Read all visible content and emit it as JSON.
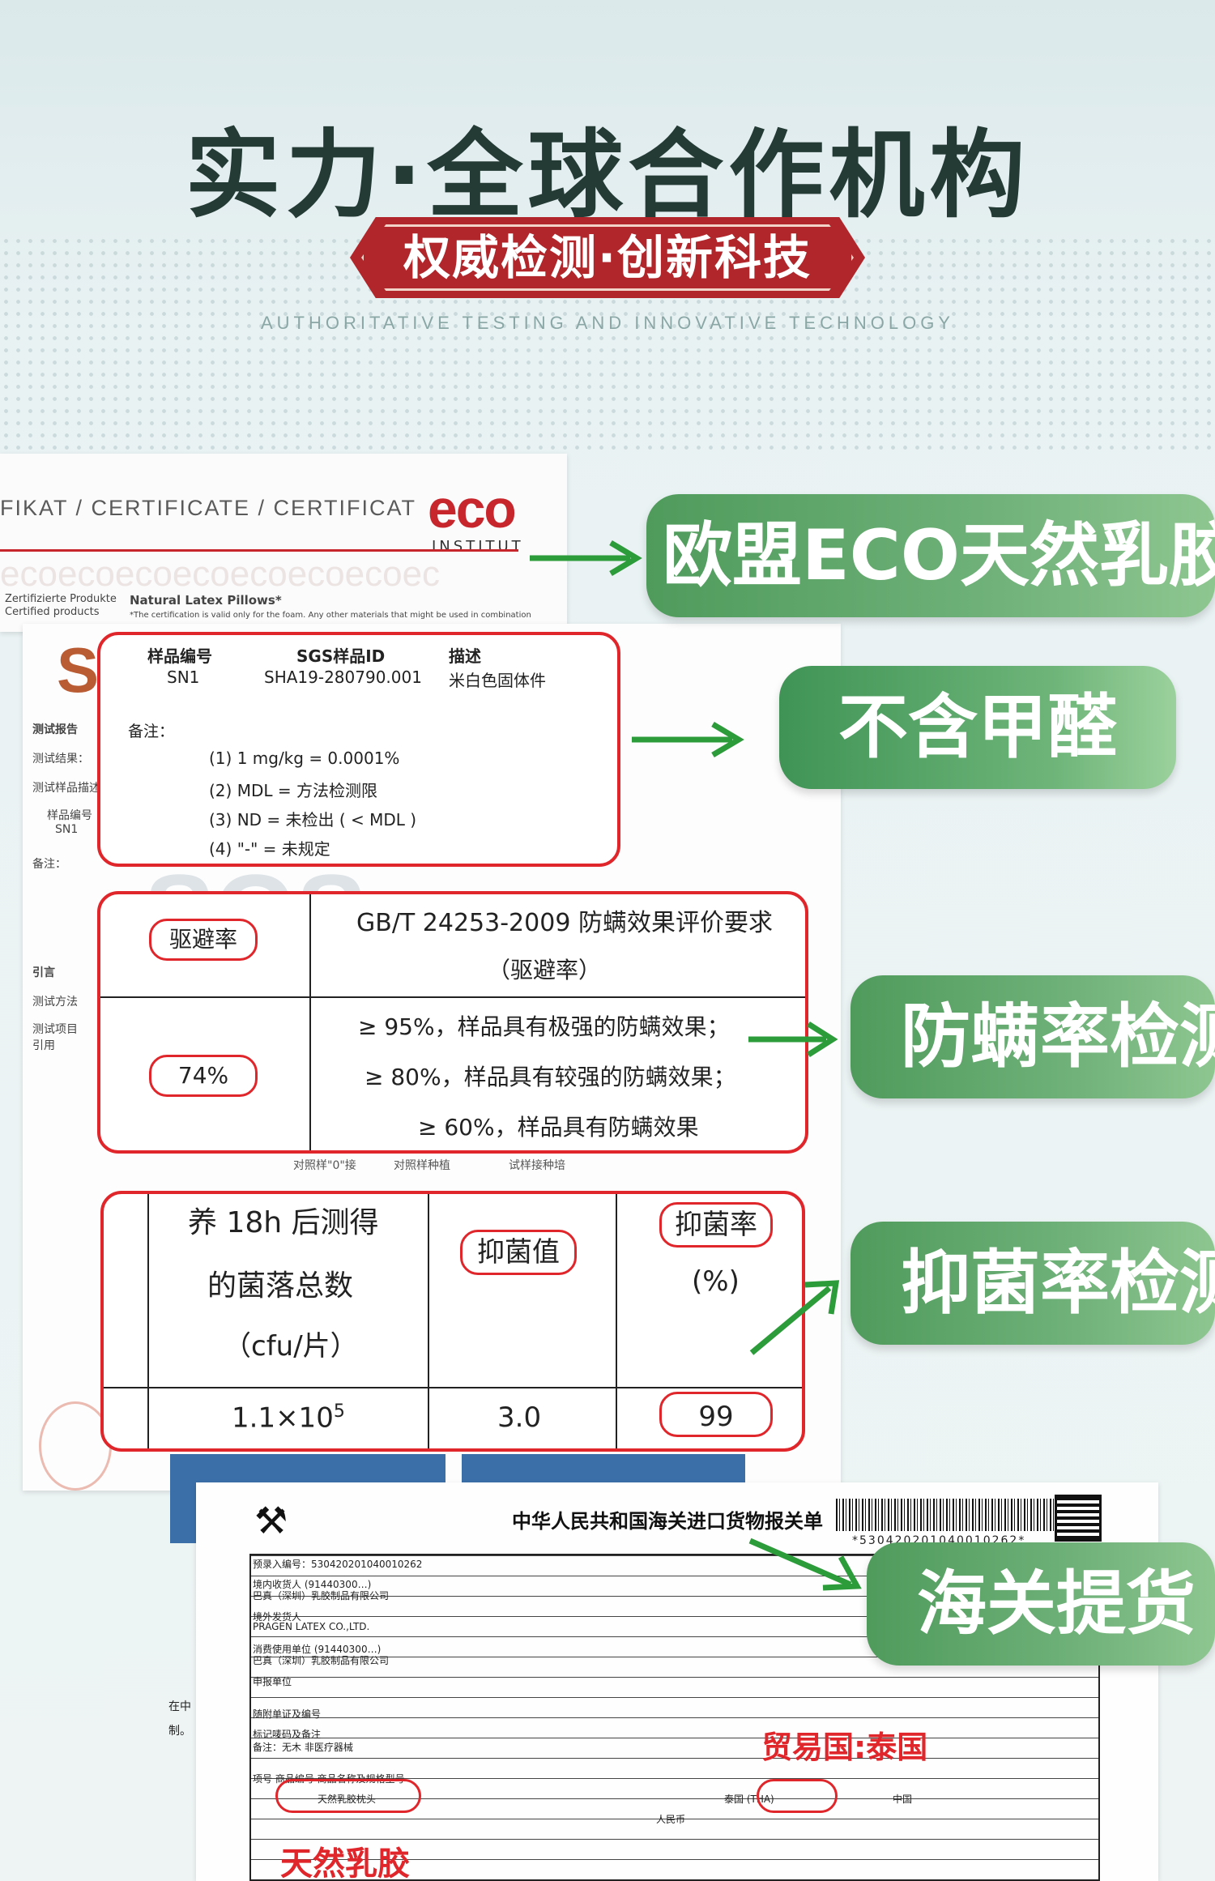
{
  "header": {
    "title": "实力·全球合作机构",
    "ribbon": "权威检测·创新科技",
    "subtitle": "AUTHORITATIVE TESTING AND INNOVATIVE TECHNOLOGY"
  },
  "eco_certificate": {
    "strip": "FIKAT / CERTIFICATE / CERTIFICAT",
    "logo": "eco",
    "institut": "INSTITUT",
    "watermark": "ecoecoecoecoecoecoecoec",
    "small_left": "Zertifizierte Produkte",
    "small_left2": "Certified products",
    "small_product": "Natural Latex Pillows*",
    "small_note": "*The certification is valid only for the foam. Any other materials that might be used in combination"
  },
  "sgs_report": {
    "logo": "SG",
    "watermark": "SGS",
    "side_labels": [
      "测试报告",
      "测试结果：",
      "测试样品描述",
      "样品编号",
      "SN1",
      "备注：",
      "引言",
      "测试方法",
      "测试项目",
      "引用"
    ]
  },
  "formaldehyde_box": {
    "headers": [
      "样品编号",
      "SGS样品ID",
      "描述"
    ],
    "row": [
      "SN1",
      "SHA19-280790.001",
      "米白色固体件"
    ],
    "notes_label": "备注：",
    "notes": [
      "(1) 1 mg/kg = 0.0001%",
      "(2) MDL = 方法检测限",
      "(3) ND = 未检出 ( < MDL )",
      "(4) \"-\" = 未规定"
    ]
  },
  "mite_box": {
    "label": "驱避率",
    "value": "74%",
    "standard_line1": "GB/T 24253-2009 防螨效果评价要求",
    "standard_line2": "（驱避率）",
    "criteria": [
      "≥ 95%，样品具有极强的防螨效果；",
      "≥ 80%，样品具有较强的防螨效果；",
      "≥ 60%，样品具有防螨效果"
    ],
    "under_headers": [
      "对照样\"0\"接",
      "对照样种植",
      "试样接种培"
    ]
  },
  "antibacterial_box": {
    "col1_line1": "养 18h 后测得",
    "col1_line2": "的菌落总数",
    "col1_line3": "（cfu/片）",
    "col2": "抑菌值",
    "col3_line1": "抑菌率",
    "col3_line2": "(%)",
    "val1": "1.1×10",
    "val1_exp": "5",
    "val2": "3.0",
    "val3": "99"
  },
  "callouts": {
    "eco": "欧盟ECO天然乳胶认证",
    "formaldehyde": "不含甲醛",
    "mite": "防螨率检测",
    "antibacterial": "抑菌率检测",
    "customs": "海关提货"
  },
  "customs_doc": {
    "title": "中华人民共和国海关进口货物报关单",
    "barcode_text": "*530420201040010262*",
    "trade_country": "贸易国:泰国",
    "natural_latex": "天然乳胶",
    "fine_print": [
      "预录入编号：530420201040010262",
      "境内收货人 (91440300…)",
      "巴真（深圳）乳胶制品有限公司",
      "境外发货人",
      "PRAGEN LATEX CO.,LTD.",
      "消费使用单位 (91440300…)",
      "巴真（深圳）乳胶制品有限公司",
      "申报单位",
      "随附单证及编号",
      "标记唛码及备注",
      "备注：无木 非医疗器械",
      "项号 商品编号 商品名称及规格型号",
      "天然乳胶枕头",
      "泰国 (THA)",
      "中国",
      "人民币"
    ],
    "side_text": [
      "在中",
      "制。"
    ]
  }
}
